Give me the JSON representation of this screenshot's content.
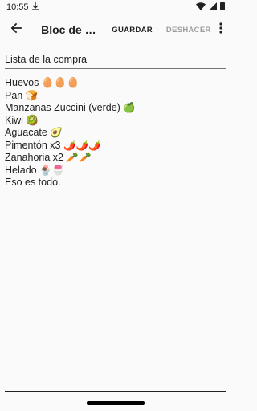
{
  "status_bar": {
    "time": "10:55",
    "icons": [
      "download-icon",
      "wifi-icon",
      "signal-icon",
      "battery-icon"
    ]
  },
  "app_bar": {
    "back_icon": "arrow-back-icon",
    "title": "Bloc de notas",
    "save_label": "GUARDAR",
    "undo_label": "DESHACER",
    "more_icon": "more-vert-icon"
  },
  "note": {
    "title": "Lista de la compra",
    "lines": [
      "Huevos 🥚🥚🥚",
      "Pan 🍞",
      "Manzanas Zuccini (verde) 🍏",
      "Kiwi 🥝",
      "Aguacate 🥑",
      "Pimentón x3 🌶️🌶️🌶️",
      "Zanahoria x2 🥕🥕",
      "Helado 🍨🍧",
      "Eso es todo."
    ]
  },
  "colors": {
    "background": "#fafafa",
    "text": "#212121",
    "disabled": "#9e9e9e"
  }
}
